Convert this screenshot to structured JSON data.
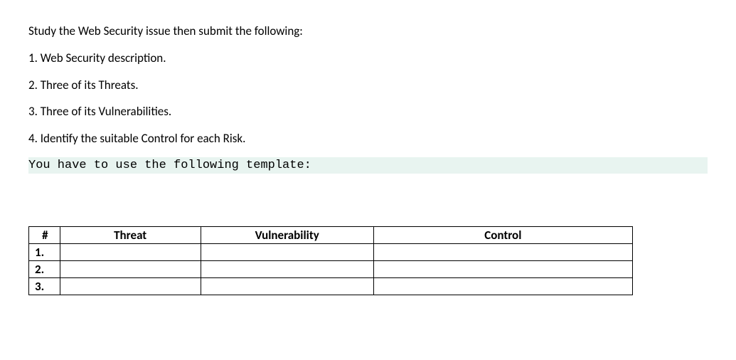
{
  "instructions": {
    "intro": "Study the Web Security issue then submit the following:",
    "item1": "1. Web Security description.",
    "item2": "2. Three of its Threats.",
    "item3": "3. Three of its Vulnerabilities.",
    "item4": "4. Identify the suitable Control for each Risk.",
    "template_note": "You have to use the following template:"
  },
  "table": {
    "headers": {
      "num": "#",
      "threat": "Threat",
      "vulnerability": "Vulnerability",
      "control": "Control"
    },
    "rows": [
      {
        "num": "1.",
        "threat": "",
        "vulnerability": "",
        "control": ""
      },
      {
        "num": "2.",
        "threat": "",
        "vulnerability": "",
        "control": ""
      },
      {
        "num": "3.",
        "threat": "",
        "vulnerability": "",
        "control": ""
      }
    ]
  }
}
